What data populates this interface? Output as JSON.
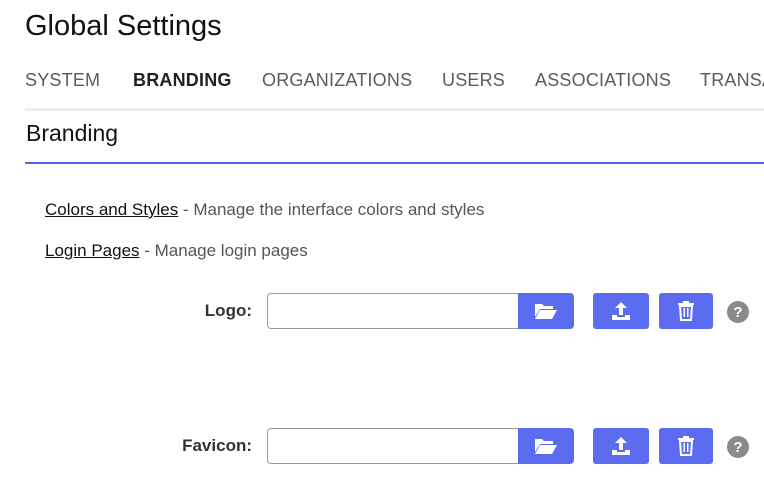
{
  "page": {
    "title": "Global Settings"
  },
  "tabs": [
    {
      "label": "SYSTEM"
    },
    {
      "label": "BRANDING",
      "active": true
    },
    {
      "label": "ORGANIZATIONS"
    },
    {
      "label": "USERS"
    },
    {
      "label": "ASSOCIATIONS"
    },
    {
      "label": "TRANSA"
    }
  ],
  "section": {
    "title": "Branding"
  },
  "links": [
    {
      "label": "Colors and Styles",
      "description": " - Manage the interface colors and styles"
    },
    {
      "label": "Login Pages",
      "description": " - Manage login pages"
    }
  ],
  "fields": {
    "logo": {
      "label": "Logo:",
      "value": ""
    },
    "favicon": {
      "label": "Favicon:",
      "value": ""
    }
  },
  "icons": {
    "browse": "folder-open-icon",
    "upload": "upload-icon",
    "delete": "trash-icon",
    "help": "question-icon",
    "help_glyph": "?"
  },
  "colors": {
    "accent": "#5b6cf0",
    "tab_underline": "#5563ea",
    "help_bg": "#8a8a8a"
  }
}
